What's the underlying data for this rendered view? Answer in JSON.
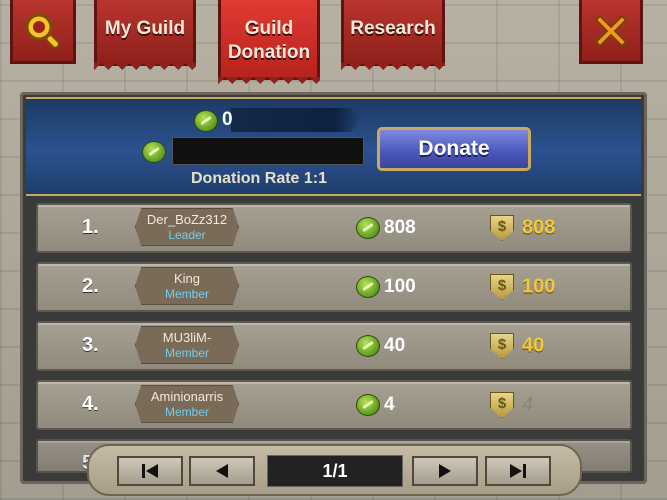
{
  "tabs": {
    "my_guild": "My Guild",
    "guild_donation_line1": "Guild",
    "guild_donation_line2": "Donation",
    "research": "Research"
  },
  "icons": {
    "search": "magnifier-icon",
    "close": "close-x-icon"
  },
  "donation": {
    "owned_amount": "0",
    "input_value": "",
    "donate_label": "Donate",
    "rate_text": "Donation Rate 1:1"
  },
  "members": [
    {
      "rank": "1.",
      "name": "Der_BoZz312",
      "role": "Leader",
      "gems": "808",
      "gold": "808"
    },
    {
      "rank": "2.",
      "name": "King",
      "role": "Member",
      "gems": "100",
      "gold": "100"
    },
    {
      "rank": "3.",
      "name": "MU3liM-",
      "role": "Member",
      "gems": "40",
      "gold": "40"
    },
    {
      "rank": "4.",
      "name": "Aminionarris",
      "role": "Member",
      "gems": "4",
      "gold": "4"
    },
    {
      "rank": "5",
      "name": "",
      "role": "",
      "gems": "",
      "gold": ""
    }
  ],
  "pager": {
    "page_text": "1/1"
  },
  "colors": {
    "tab_red": "#b8352e",
    "panel_blue": "#2b5290",
    "gold": "#f2c93a",
    "role_cyan": "#6fd0f0"
  }
}
